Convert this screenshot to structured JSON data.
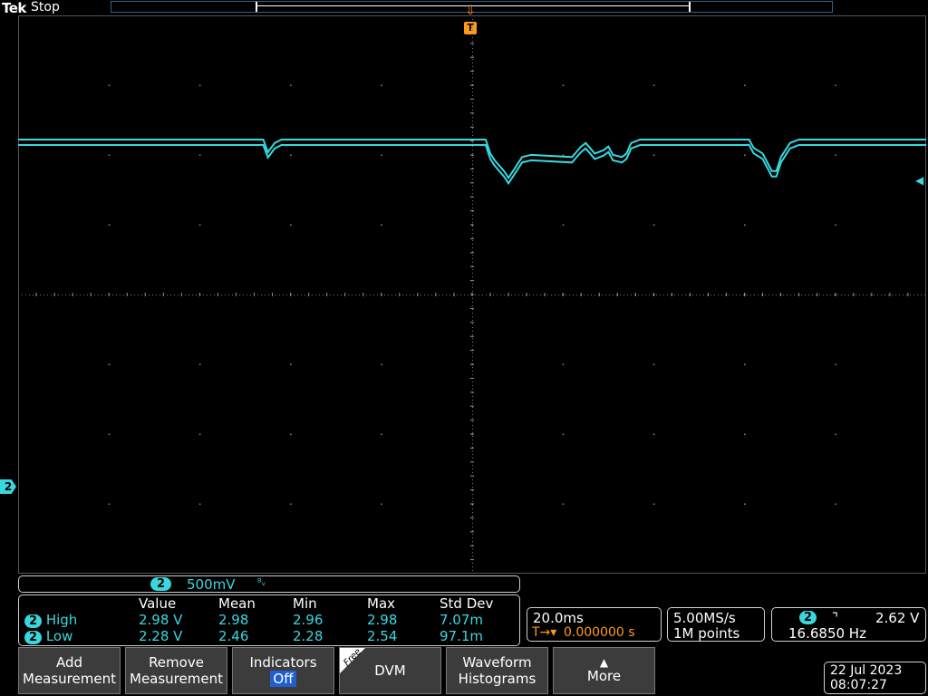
{
  "header": {
    "brand": "Tek",
    "acq_state": "Stop",
    "trigger_label": "T"
  },
  "channel": {
    "number": "2",
    "scale": "500mV",
    "bw_symbol": "ᴮᵥ",
    "color": "#38d8e0"
  },
  "waveform": {
    "description_points_ms": [
      [
        0,
        0.0
      ],
      [
        54,
        0.0
      ],
      [
        55,
        -0.18
      ],
      [
        56.5,
        -0.05
      ],
      [
        58,
        0.0
      ],
      [
        103,
        0.0
      ],
      [
        104,
        -0.2
      ],
      [
        105,
        -0.3
      ],
      [
        107,
        -0.45
      ],
      [
        108,
        -0.55
      ],
      [
        109,
        -0.45
      ],
      [
        110,
        -0.35
      ],
      [
        111,
        -0.25
      ],
      [
        113,
        -0.22
      ],
      [
        122,
        -0.25
      ],
      [
        124,
        -0.1
      ],
      [
        125,
        -0.05
      ],
      [
        127,
        -0.2
      ],
      [
        129,
        -0.15
      ],
      [
        130,
        -0.1
      ],
      [
        131,
        -0.22
      ],
      [
        133,
        -0.25
      ],
      [
        134,
        -0.2
      ],
      [
        135,
        -0.05
      ],
      [
        137,
        0.0
      ],
      [
        161,
        0.0
      ],
      [
        162,
        -0.12
      ],
      [
        164,
        -0.2
      ],
      [
        166,
        -0.45
      ],
      [
        167,
        -0.45
      ],
      [
        168,
        -0.25
      ],
      [
        170,
        -0.05
      ],
      [
        172,
        0.0
      ],
      [
        200,
        0.0
      ]
    ],
    "total_time_ms": 200
  },
  "measurements": {
    "headers": [
      "Value",
      "Mean",
      "Min",
      "Max",
      "Std Dev"
    ],
    "rows": [
      {
        "ch": "2",
        "name": "High",
        "value": "2.98 V",
        "mean": "2.98",
        "min": "2.96",
        "max": "2.98",
        "std": "7.07m"
      },
      {
        "ch": "2",
        "name": "Low",
        "value": "2.28 V",
        "mean": "2.46",
        "min": "2.28",
        "max": "2.54",
        "std": "97.1m"
      }
    ]
  },
  "timebase": {
    "scale": "20.0ms",
    "trigger_pos": "0.000000 s",
    "trigger_icon": "T→▾"
  },
  "sampling": {
    "rate": "5.00MS/s",
    "points": "1M points"
  },
  "trigger": {
    "ch": "2",
    "slope_symbol": "⌝",
    "level": "2.62 V",
    "freq": "16.6850 Hz"
  },
  "buttons": {
    "add": [
      "Add",
      "Measurement"
    ],
    "remove": [
      "Remove",
      "Measurement"
    ],
    "indicators": [
      "Indicators",
      "Off"
    ],
    "dvm": "DVM",
    "dvm_tag": "Free",
    "histograms": [
      "Waveform",
      "Histograms"
    ],
    "more": "More"
  },
  "datetime": {
    "date": "22 Jul  2023",
    "time": "08:07:27"
  }
}
